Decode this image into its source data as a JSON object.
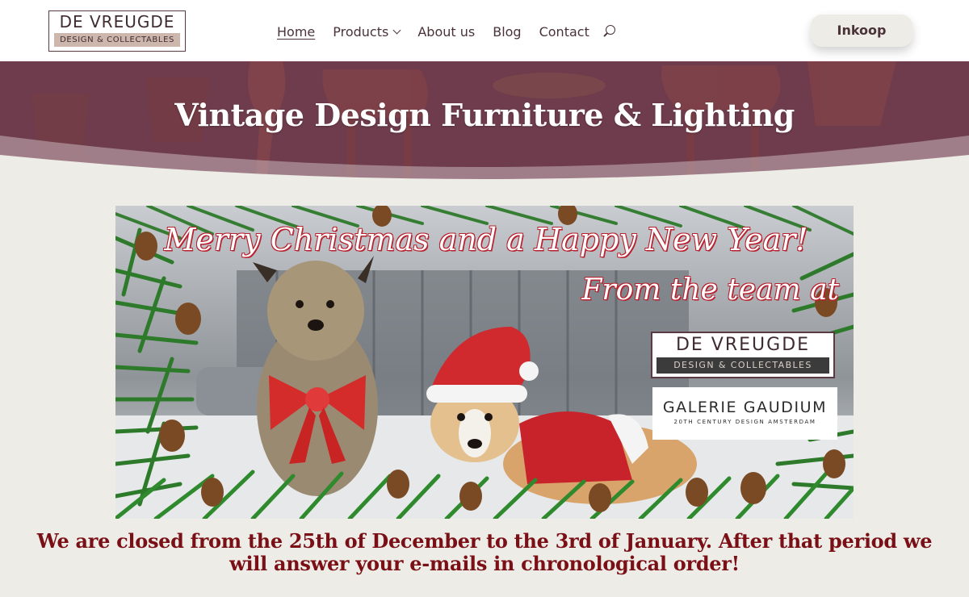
{
  "header": {
    "logo": {
      "line1": "DE VREUGDE",
      "line2": "DESIGN & COLLECTABLES"
    },
    "nav": [
      {
        "label": "Home",
        "active": true
      },
      {
        "label": "Products",
        "has_dropdown": true
      },
      {
        "label": "About us"
      },
      {
        "label": "Blog"
      },
      {
        "label": "Contact"
      }
    ],
    "search_icon": "search-icon",
    "cta_label": "Inkoop"
  },
  "hero": {
    "title": "Vintage Design Furniture & Lighting",
    "color": "#6e3c4c"
  },
  "banner": {
    "headline": "Merry Christmas and a Happy New Year!",
    "subline": "From the team at",
    "logo_devreugde": {
      "line1": "DE VREUGDE",
      "line2": "DESIGN & COLLECTABLES"
    },
    "logo_gaudium": {
      "line1": "GALERIE GAUDIUM",
      "line2": "20TH CENTURY DESIGN AMSTERDAM"
    }
  },
  "notice": {
    "text": "We are closed from the 25th of December to the 3rd of January. After that period we will answer your e-mails in chronological order!",
    "color": "#7a1016"
  },
  "colors": {
    "page_bg": "#edece7",
    "accent": "#6e3c4c",
    "text": "#4a3338"
  }
}
